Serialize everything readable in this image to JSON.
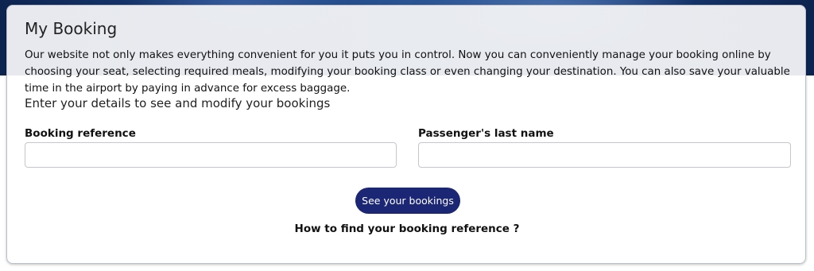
{
  "booking": {
    "title": "My Booking",
    "description": "Our website not only makes everything convenient for you it puts you in control. Now you can conveniently manage your booking online by choosing your seat, selecting required meals, modifying your booking class or even changing your destination. You can also save your valuable time in the airport by paying in advance for excess baggage.",
    "subtitle": "Enter your details to see and modify your bookings",
    "reference_label": "Booking reference",
    "reference_value": "",
    "last_name_label": "Passenger's last name",
    "last_name_value": "",
    "submit_label": "See your bookings",
    "help_link": "How to find your booking reference ?"
  },
  "colors": {
    "button": "#1b2675",
    "hero_background": "#1a3d78"
  }
}
